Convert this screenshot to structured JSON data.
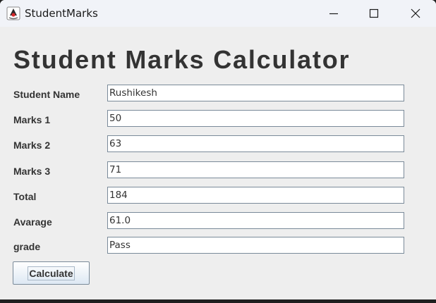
{
  "window": {
    "title": "StudentMarks",
    "icon": "java-duke-icon"
  },
  "form": {
    "heading": "Student Marks Calculator",
    "fields": [
      {
        "label": "Student Name",
        "value": "Rushikesh"
      },
      {
        "label": "Marks 1",
        "value": "50"
      },
      {
        "label": "Marks 2",
        "value": "63"
      },
      {
        "label": "Marks 3",
        "value": "71"
      },
      {
        "label": "Total",
        "value": "184"
      },
      {
        "label": "Avarage",
        "value": "61.0"
      },
      {
        "label": "grade",
        "value": "Pass"
      }
    ],
    "calculate_label": "Calculate"
  }
}
